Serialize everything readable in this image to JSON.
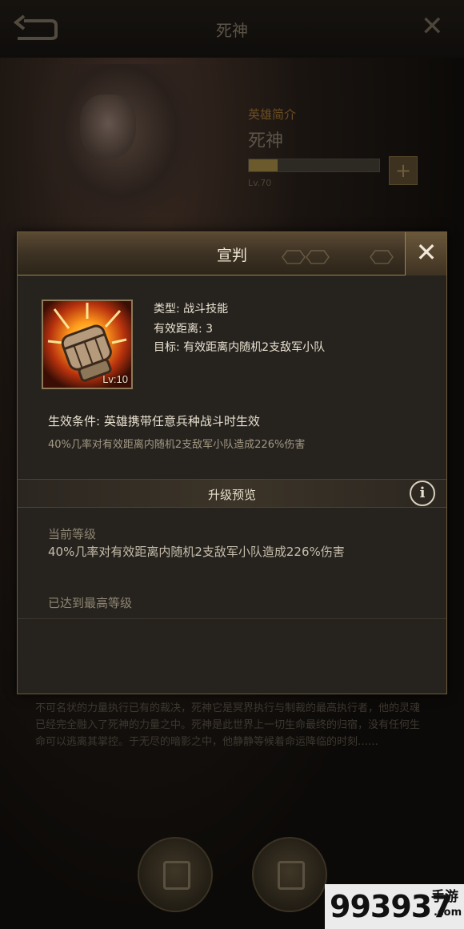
{
  "background": {
    "title": "死神",
    "subtitle": "英雄简介",
    "hero_name": "死神",
    "level_text": "Lv.70",
    "progress": 0.22,
    "description": "不可名状的力量执行已有的裁决，死神它是冥界执行与制裁的最高执行者，他的灵魂已经完全融入了死神的力量之中。死神是此世界上一切生命最终的归宿，没有任何生命可以逃离其掌控。于无尽的暗影之中，他静静等候着命运降临的时刻……"
  },
  "dialog": {
    "title": "宣判",
    "close_symbol": "✕",
    "skill": {
      "level_label": "Lv:10",
      "type_line": "类型: 战斗技能",
      "range_line": "有效距离: 3",
      "target_line": "目标: 有效距离内随机2支敌军小队"
    },
    "condition": {
      "title": "生效条件: 英雄携带任意兵种战斗时生效",
      "description": "40%几率对有效距离内随机2支敌军小队造成226%伤害"
    },
    "upgrade": {
      "section_title": "升级预览",
      "info_symbol": "i",
      "current_label": "当前等级",
      "current_description": "40%几率对有效距离内随机2支敌军小队造成226%伤害",
      "max_level_text": "已达到最高等级"
    }
  },
  "watermark": {
    "number": "993937",
    "cn": "手游",
    "domain": ".com"
  },
  "icons": [
    "back-arrow-icon",
    "close-icon",
    "fist-skill-icon",
    "info-icon",
    "plus-icon"
  ],
  "colors": {
    "accent_gold": "#a0834f",
    "dialog_bg": "#26231f",
    "text_primary": "#eae2d2",
    "text_muted": "#8e8572"
  }
}
